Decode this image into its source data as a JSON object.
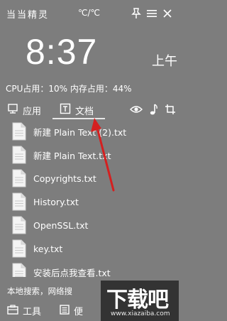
{
  "header": {
    "app_title": "当当精灵",
    "temperature": "℃/℃"
  },
  "clock": {
    "time": "8:37",
    "ampm": "上午"
  },
  "stats": {
    "text": "CPU占用：10%  内存占用：44%"
  },
  "tabs": [
    {
      "label": "应用",
      "icon": "monitor-icon"
    },
    {
      "label": "文档",
      "icon": "text-doc-icon"
    }
  ],
  "files": [
    {
      "name": "新建 Plain Text (2).txt"
    },
    {
      "name": "新建 Plain Text.txt"
    },
    {
      "name": "Copyrights.txt"
    },
    {
      "name": "History.txt"
    },
    {
      "name": "OpenSSL.txt"
    },
    {
      "name": "key.txt"
    },
    {
      "name": "安装后点我查看.txt"
    }
  ],
  "search_hint": "本地搜索，网络搜",
  "bottom": {
    "tools_label": "工具",
    "convenience_label": "便"
  },
  "watermark": {
    "big": "下载吧",
    "small": "www.xiazaiba.com"
  },
  "colors": {
    "background": "#7d7d7d",
    "text": "#ffffff",
    "arrow": "#d42020"
  }
}
